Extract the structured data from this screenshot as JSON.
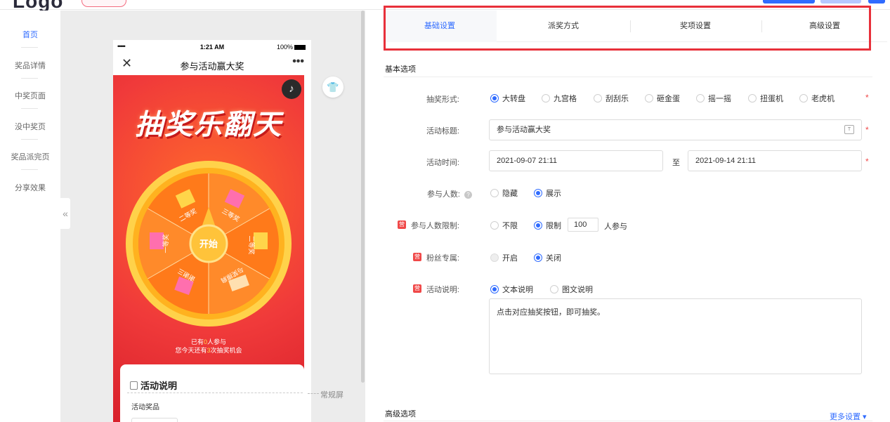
{
  "topbar": {
    "logo": "Logo"
  },
  "nav": [
    "首页",
    "奖品详情",
    "中奖页面",
    "没中奖页",
    "奖品派完页",
    "分享效果"
  ],
  "canvas": {
    "collapse_glyph": "«",
    "screen_mode": "常规屏"
  },
  "phone": {
    "signal": "•••••",
    "time": "1:21 AM",
    "battery": "100%",
    "close": "✕",
    "title": "参与活动赢大奖",
    "more": "•••",
    "poster_title": "抽奖乐翻天",
    "wheel_center": "开始",
    "prizes": [
      "二等奖",
      "三等奖",
      "二等奖",
      "与奖擦肩",
      "谢谢三",
      "一等奖"
    ],
    "participants_prefix": "已有",
    "participants_count": "0",
    "participants_suffix": "人参与",
    "chances_prefix": "您今天还有",
    "chances_count": "3",
    "chances_suffix": "次抽奖机会",
    "desc_title": "活动说明",
    "desc_sub": "活动奖品"
  },
  "tabs": [
    "基础设置",
    "派奖方式",
    "奖项设置",
    "高级设置"
  ],
  "basic": {
    "section": "基本选项",
    "form_type_label": "抽奖形式:",
    "form_types": [
      "大转盘",
      "九宫格",
      "刮刮乐",
      "砸金蛋",
      "摇一摇",
      "扭蛋机",
      "老虎机"
    ],
    "title_label": "活动标题:",
    "title_value": "参与活动赢大奖",
    "time_label": "活动时间:",
    "time_start": "2021-09-07 21:11",
    "time_to": "至",
    "time_end": "2021-09-14 21:11",
    "count_label": "参与人数:",
    "count_options": [
      "隐藏",
      "展示"
    ],
    "limit_label": "参与人数限制:",
    "limit_options": [
      "不限",
      "限制"
    ],
    "limit_value": "100",
    "limit_suffix": "人参与",
    "fans_label": "粉丝专属:",
    "fans_options": [
      "开启",
      "关闭"
    ],
    "desc_label": "活动说明:",
    "desc_options": [
      "文本说明",
      "图文说明"
    ],
    "desc_text": "点击对应抽奖按钮，即可抽奖。",
    "pro_badge": "营"
  },
  "advanced": {
    "section": "高级选项",
    "more": "更多设置 ▾"
  }
}
